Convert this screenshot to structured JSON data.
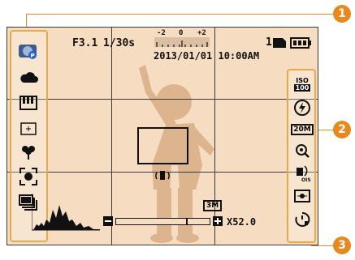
{
  "status_bar": {
    "aperture": "F3.1",
    "shutter": "1/30s",
    "ev_min": "-2",
    "ev_mid": "0",
    "ev_max": "+2",
    "shots": "1",
    "datetime": "2013/01/01 10:00AM"
  },
  "left_panel_icons": [
    "smart-mode-icon",
    "cloud-icon",
    "piano-icon",
    "spot-focus-icon",
    "macro-flower-icon",
    "face-detect-icon",
    "burst-icon"
  ],
  "right_panel": {
    "iso_top": "ISO",
    "iso_bottom": "100",
    "size": "20M"
  },
  "zoom": {
    "zoom_value": "X52.0",
    "mode_badge": "3M"
  },
  "callouts": {
    "c1": "1",
    "c2": "2",
    "c3": "3"
  },
  "colors": {
    "accent": "#e8891e",
    "screen_bg": "#f6dcc0",
    "silhouette": "#dcb48e"
  }
}
